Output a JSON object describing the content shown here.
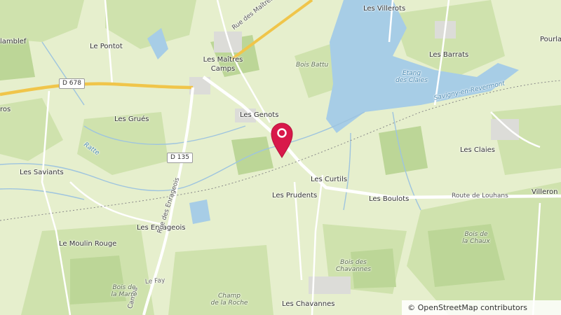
{
  "map": {
    "marker": {
      "name": "location-marker",
      "color": "#d8194a"
    },
    "attribution": "© OpenStreetMap contributors",
    "road_shields": [
      "D 678",
      "D 135"
    ],
    "places": [
      "Les Villerots",
      "Pourla",
      "lamblef",
      "Le Pontot",
      "Les Maîtres Camps",
      "Les Barrats",
      "Les Genots",
      "Les Grués",
      "Les Claies",
      "Les Saviants",
      "Les Curtils",
      "Les Prudents",
      "Les Boulots",
      "Villeron",
      "Les Enrageois",
      "Le Moulin Rouge",
      "Les Chavannes",
      "Le Fay",
      "ros"
    ],
    "roads": {
      "maitres_camps": "Rue des Maîtres Camps",
      "enrageois": "Rue des Enrageois",
      "louhans": "Route de Louhans",
      "campa": "Campa"
    },
    "water": {
      "etang_1": "Etang",
      "etang_2": "des Claies",
      "ratte": "Ratte",
      "savigny": "Savigny-en-Revermont"
    },
    "woods": {
      "battu": "Bois Battu",
      "chaux_1": "Bois de",
      "chaux_2": "la Chaux",
      "chav_1": "Bois des",
      "chav_2": "Chavannes",
      "marre_1": "Bois de",
      "marre_2": "la Marre",
      "roche_1": "Champ",
      "roche_2": "de la Roche"
    }
  }
}
